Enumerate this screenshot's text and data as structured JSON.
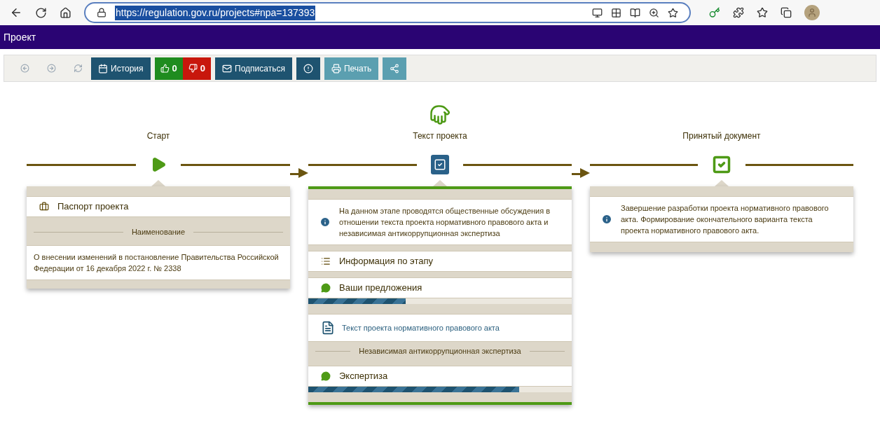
{
  "browser": {
    "url": "https://regulation.gov.ru/projects#npa=137393"
  },
  "header": {
    "title": "Проект"
  },
  "toolbar": [
    {
      "kind": "back"
    },
    {
      "kind": "forward"
    },
    {
      "kind": "refresh"
    },
    {
      "kind": "history",
      "label": "История",
      "disabled": false
    },
    {
      "kind": "like",
      "label": "0"
    },
    {
      "kind": "dislike",
      "label": "0"
    },
    {
      "kind": "subscribe",
      "label": "Подписаться",
      "disabled": false
    },
    {
      "kind": "alert",
      "disabled": false
    },
    {
      "kind": "print",
      "label": "Печать",
      "disabled": true
    },
    {
      "kind": "share",
      "disabled": true
    }
  ],
  "stages": [
    {
      "title": "Старт",
      "active": false,
      "items": [
        {
          "kind": "passport",
          "text": "Паспорт проекта"
        },
        {
          "kind": "section",
          "text": "Наименование"
        },
        {
          "kind": "text",
          "text": "О внесении изменений в постановление Правительства Российской Федерации от 16 декабря 2022 г. № 2338"
        }
      ]
    },
    {
      "title": "Текст проекта",
      "active": true,
      "items": [
        {
          "kind": "info",
          "text": "На данном этапе проводятся общественные обсуждения в отношении текста проекта нормативного правового акта и независимая антикоррупционная экспертиза"
        },
        {
          "kind": "details",
          "text": "Информация по этапу"
        },
        {
          "kind": "progress",
          "text": "Ваши предложения",
          "level": 0.37
        },
        {
          "kind": "doc",
          "text": "Текст проекта нормативного правового акта"
        },
        {
          "kind": "section",
          "text": "Независимая антикоррупционная экспертиза"
        },
        {
          "kind": "progress",
          "text": "Экспертиза",
          "level": 0.8
        }
      ]
    },
    {
      "title": "Принятый документ",
      "active": false,
      "items": [
        {
          "kind": "info",
          "text": "Завершение разработки проекта нормативного правового акта. Формирование окончательного варианта текста проекта нормативного правового акта."
        }
      ]
    }
  ]
}
